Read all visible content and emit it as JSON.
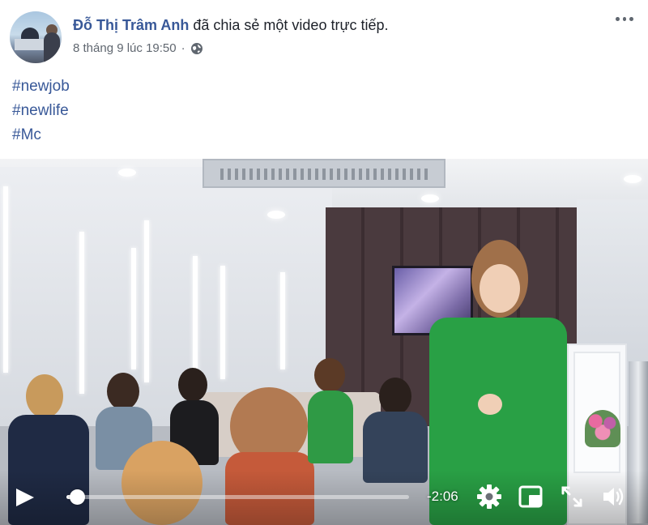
{
  "post": {
    "author_name": "Đỗ Thị Trâm Anh",
    "action_text": "đã chia sẻ một video trực tiếp.",
    "timestamp": "8 tháng 9 lúc 19:50",
    "separator": "·",
    "audience_icon": "globe-icon",
    "menu_icon": "more-options-icon"
  },
  "hashtags": [
    "#newjob",
    "#newlife",
    "#Mc"
  ],
  "video": {
    "time_remaining": "-2:06",
    "progress_fraction": 0.03,
    "controls": {
      "play_icon": "play-icon",
      "settings_icon": "gear-icon",
      "mini_player_icon": "picture-in-picture-icon",
      "fullscreen_icon": "fullscreen-icon",
      "volume_icon": "speaker-icon"
    }
  },
  "colors": {
    "link": "#385898",
    "text": "#1d2129",
    "meta": "#606770",
    "control": "#ffffff"
  }
}
